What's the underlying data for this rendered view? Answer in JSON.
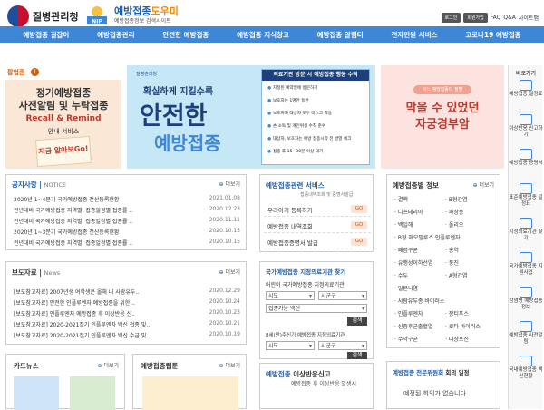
{
  "header": {
    "org_name": "질병관리청",
    "brand_title_a": "예방접종",
    "brand_title_b": "도우미",
    "brand_sub": "예방접종정보 검색사이트",
    "top_links": [
      "로그인",
      "회원가입",
      "FAQ",
      "Q&A",
      "사이트맵"
    ]
  },
  "nav": [
    "예방접종 길잡이",
    "예방접종관리",
    "안전한 예방접종",
    "예방접종 지식창고",
    "예방접종 알림터",
    "전자민원 서비스",
    "코로나19 예방접종"
  ],
  "popup": {
    "heading": "팝업존",
    "count": "1",
    "banner1": {
      "line1": "정기예방접종",
      "line2": "사전알림 및 누락접종",
      "line3": "Recall & Remind",
      "line4": "안내 서비스",
      "note": "지금 알아보Go!"
    },
    "banner2": {
      "org": "질병관리청",
      "line1": "확실하게 지킬수록",
      "line2": "안전한",
      "line3": "예방접종",
      "box_title": "의료기관 방문 시 예방접종 행동 수칙",
      "rules": [
        "지정된 예약일에 방문하기",
        "보호자는 1명만 동반",
        "보호자와 대상자 모두 마스크 착용",
        "손 소독 및 개인위생 수칙 준수",
        "대상자, 보호자는 예방 접종시작 전 발열 체크",
        "접종 후 15~30분 이상 대기"
      ]
    },
    "banner3": {
      "pill": "어느 예방접종이 정말",
      "line1": "막을 수 있었던",
      "line2": "자궁경부암"
    }
  },
  "sidebar": {
    "title": "바로가기",
    "items": [
      "예방접종 일정표",
      "이상반응 신고하기",
      "예방접종 증명서",
      "표준예방접종 일정표",
      "지정의료기관 찾기",
      "국가예방접종 지원사업",
      "감염병 예방접종 정보",
      "예방접종 사전알림",
      "국내예방접종 백신현황"
    ]
  },
  "notice": {
    "title": "공지사항",
    "sub": "NOTICE",
    "more": "더보기",
    "rows": [
      {
        "text": "2020년 1~4분기 국가예방접종 전산등록현황",
        "date": "2021.01.08"
      },
      {
        "text": "전년대비 국가예방접종 지역별, 접종일정별 접종률 ..",
        "date": "2020.12.23"
      },
      {
        "text": "전년대비 국가예방접종 지역별, 접종일정별 접종률 ..",
        "date": "2020.11.11"
      },
      {
        "text": "2020년 1~3분기 국가예방접종 전산등록현황",
        "date": "2020.10.15"
      },
      {
        "text": "전년대비 국가예방접종 지역별, 접종일정별 접종률 ..",
        "date": "2020.10.15"
      }
    ]
  },
  "press": {
    "title": "보도자료",
    "sub": "News",
    "more": "더보기",
    "rows": [
      {
        "text": "[보도참고자료] 2007년생 여학생은 올해 내 사람유두..",
        "date": "2020.12.29"
      },
      {
        "text": "[보도참고자료] 안전한 인플루엔자 예방접종을 위한 ..",
        "date": "2020.10.24"
      },
      {
        "text": "[보도참고자료] 인플루엔자 예방접종 후 이상반응 신..",
        "date": "2020.10.23"
      },
      {
        "text": "[보도참고자료] 2020-2021절기 인플루엔자 백신 접종 및..",
        "date": "2020.10.21"
      },
      {
        "text": "[보도참고자료] 2020-2021절기 인플루엔자 백신 수급 및..",
        "date": "2020.10.19"
      }
    ]
  },
  "cardnews": {
    "title": "카드뉴스",
    "more": "더보기"
  },
  "webtoon": {
    "title": "예방접종웹툰",
    "more": "더보기"
  },
  "services": {
    "title": "예방접종관련 서비스",
    "sub": "접종내역조회 및 증명서발급",
    "rows": [
      {
        "label": "우리아기 등록하기",
        "badge": "GO"
      },
      {
        "label": "예방접종 내역조회",
        "badge": "GO"
      },
      {
        "label": "예방접종증명서 발급",
        "badge": "GO"
      }
    ]
  },
  "finder": {
    "title": "국가예방접종 지정의료기관 찾기",
    "q1": "어린이 국가예방접종 지정의료기관",
    "sido": "시도",
    "sigungu": "시군구",
    "vaccine": "접종가능 백신",
    "search": "검색",
    "q2": "8세(만)주신기 예방접종 지정의료기관"
  },
  "disease": {
    "title": "예방접종별 정보",
    "more": "더보기",
    "col1": [
      "결핵",
      "디프테리아",
      "백일해",
      "B형 헤모필루스 인플루엔자",
      "폐렴구균",
      "유행성이하선염",
      "수두",
      "일본뇌염",
      "사람유두종 바이러스",
      "인플루엔자",
      "신증후군출혈열",
      "수막구균"
    ],
    "col2": [
      "B형간염",
      "파상풍",
      "폴리오",
      "홍역",
      "풍진",
      "A형간염",
      "장티푸스",
      "로타 바이러스",
      "대상포진"
    ]
  },
  "committee": {
    "title": "예방접종 전문위원회",
    "title2": "회의 일정",
    "empty": "예정된 회의가 없습니다."
  },
  "adverse": {
    "title": "예방접종",
    "title2": "이상반응신고",
    "desc": "예방접종 후 이상반응 발생시"
  }
}
